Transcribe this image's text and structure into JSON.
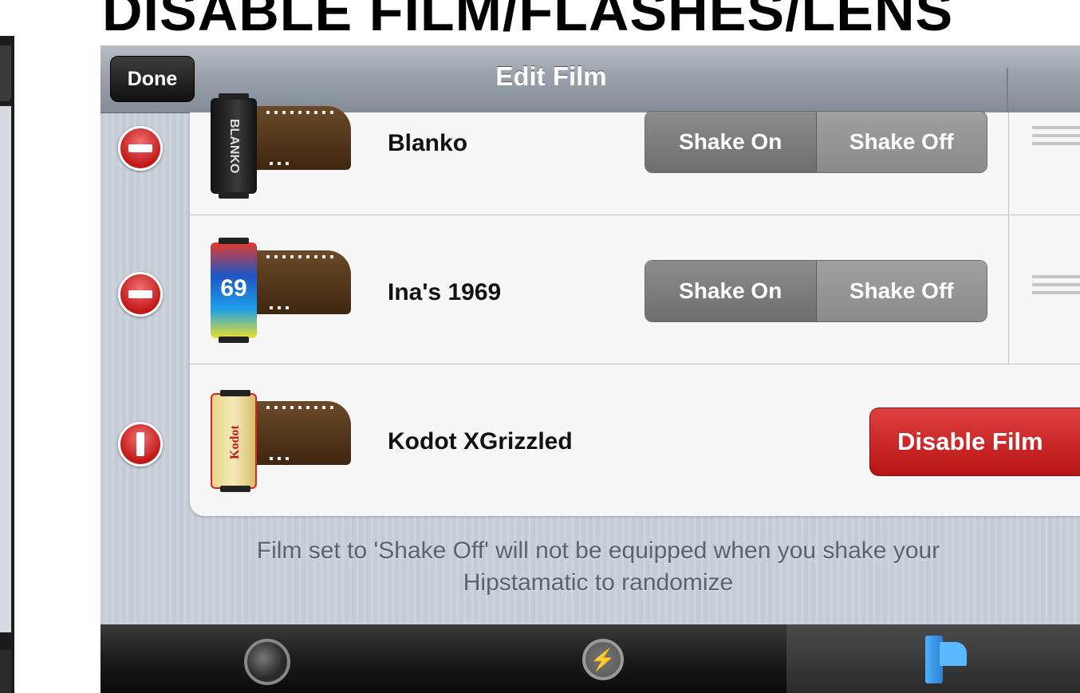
{
  "headline": "DISABLE FILM/FLASHES/LENS",
  "nav": {
    "title": "Edit Film",
    "done_label": "Done"
  },
  "films": [
    {
      "name": "Blanko",
      "canister_label": "BLANKO",
      "shake_on": "Shake On",
      "shake_off": "Shake Off"
    },
    {
      "name": "Ina's 1969",
      "canister_label": "69",
      "shake_on": "Shake On",
      "shake_off": "Shake Off"
    },
    {
      "name": "Kodot XGrizzled",
      "canister_label": "Kodot",
      "disable_label": "Disable Film"
    }
  ],
  "footer": {
    "line1": "Film set to 'Shake Off' will not be equipped when you shake your",
    "line2": "Hipstamatic to randomize"
  },
  "tabs": [
    {
      "icon": "lens-icon"
    },
    {
      "icon": "flash-icon"
    },
    {
      "icon": "film-icon",
      "selected": true
    }
  ],
  "colors": {
    "delete_red": "#c21818",
    "disable_red": "#c81c1c",
    "nav_gray": "#9aa1ab"
  }
}
